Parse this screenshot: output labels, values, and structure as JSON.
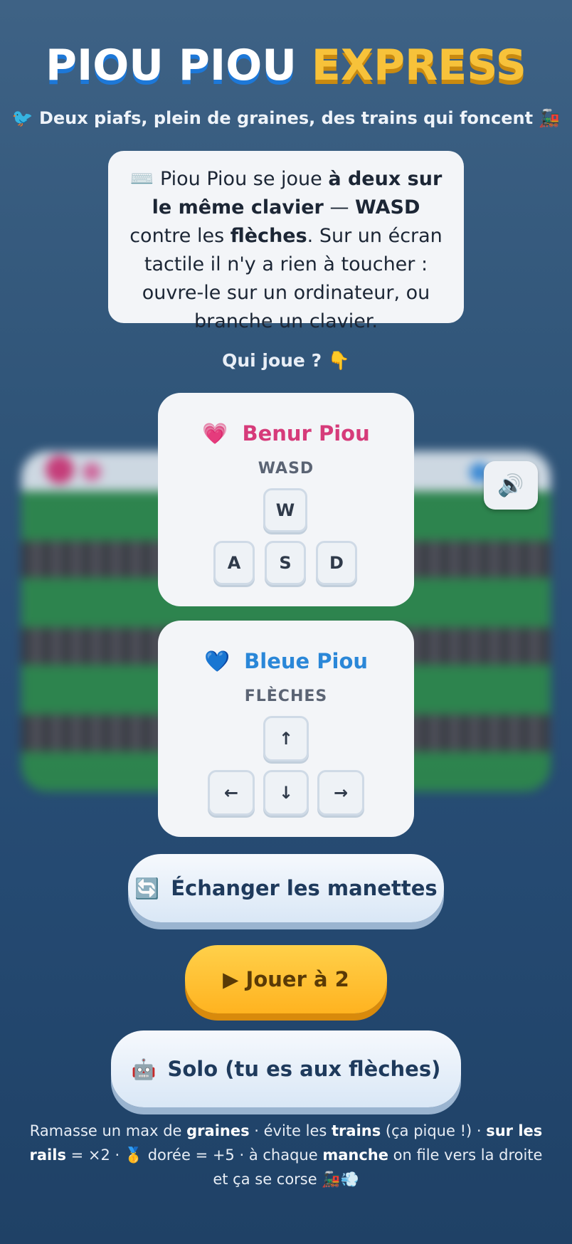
{
  "title": {
    "part1": "PIOU PIOU",
    "part2": "EXPRESS"
  },
  "subtitle": {
    "icon": "🐦",
    "text": "Deux piafs, plein de graines, des trains qui foncent",
    "trail_icon": "🚂"
  },
  "notice": {
    "icon": "⌨️",
    "t1": "Piou Piou se joue ",
    "b1": "à deux sur le même clavier",
    "t2": " — ",
    "b2": "WASD",
    "t3": " contre les ",
    "b3": "flèches",
    "t4": ". Sur un écran tactile il n'y a rien à toucher : ouvre-le sur un ordinateur, ou branche un clavier."
  },
  "who_plays": "Qui joue ? 👇",
  "sound_button": {
    "icon": "🔊"
  },
  "player1": {
    "heart": "💗",
    "name": "Benur Piou",
    "scheme": "WASD",
    "keys": {
      "up": "W",
      "left": "A",
      "down": "S",
      "right": "D"
    },
    "color": "#d63b7a"
  },
  "player2": {
    "heart": "💙",
    "name": "Bleue Piou",
    "scheme": "FLÈCHES",
    "keys": {
      "up": "↑",
      "left": "←",
      "down": "↓",
      "right": "→"
    },
    "color": "#2a87d8"
  },
  "buttons": {
    "swap": {
      "icon": "🔄",
      "label": "Échanger les manettes"
    },
    "play": {
      "label": "▶ Jouer à 2"
    },
    "solo": {
      "icon": "🤖",
      "label": "Solo (tu es aux flèches)"
    }
  },
  "rules": {
    "t1": "Ramasse un max de ",
    "b1": "graines",
    "t2": " · évite les ",
    "b2": "trains",
    "t3": " (ça pique !) · ",
    "b3": "sur les rails",
    "t4": " = ×2 · 🥇 dorée = +5 · à chaque ",
    "b4": "manche",
    "t5": " on file vers la droite et ça se corse 🚂💨"
  },
  "colors": {
    "accent_yellow": "#f7c23a",
    "accent_blue": "#1d78d8",
    "background": "#2f5478"
  }
}
